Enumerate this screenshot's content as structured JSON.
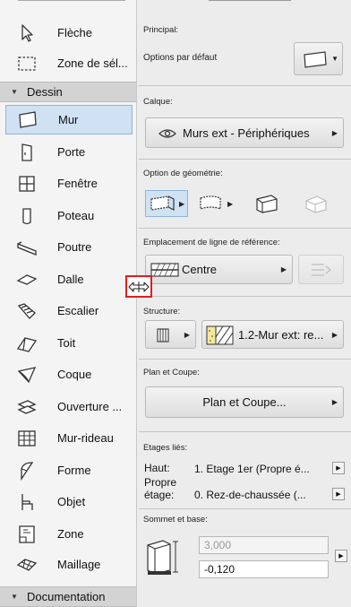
{
  "toolbox": {
    "tools_top": [
      {
        "label": "Flèche",
        "icon": "arrow-pointer-icon"
      },
      {
        "label": "Zone de sél...",
        "icon": "marquee-icon"
      }
    ],
    "section_dessin": "Dessin",
    "tools": [
      {
        "label": "Mur",
        "icon": "wall-icon",
        "selected": true
      },
      {
        "label": "Porte",
        "icon": "door-icon"
      },
      {
        "label": "Fenêtre",
        "icon": "window-icon"
      },
      {
        "label": "Poteau",
        "icon": "column-icon"
      },
      {
        "label": "Poutre",
        "icon": "beam-icon"
      },
      {
        "label": "Dalle",
        "icon": "slab-icon"
      },
      {
        "label": "Escalier",
        "icon": "stair-icon"
      },
      {
        "label": "Toit",
        "icon": "roof-icon"
      },
      {
        "label": "Coque",
        "icon": "shell-icon"
      },
      {
        "label": "Ouverture ...",
        "icon": "opening-icon"
      },
      {
        "label": "Mur-rideau",
        "icon": "curtain-wall-icon"
      },
      {
        "label": "Forme",
        "icon": "morph-icon"
      },
      {
        "label": "Objet",
        "icon": "object-chair-icon"
      },
      {
        "label": "Zone",
        "icon": "zone-icon"
      },
      {
        "label": "Maillage",
        "icon": "mesh-icon"
      }
    ],
    "section_documentation": "Documentation"
  },
  "panel": {
    "principal_caption": "Principal:",
    "options_default": "Options par défaut",
    "calque_caption": "Calque:",
    "layer_value": "Murs ext - Périphériques",
    "geometry_caption": "Option de géométrie:",
    "refline_caption": "Emplacement de ligne de référence:",
    "refline_value": "Centre",
    "structure_caption": "Structure:",
    "structure_value": "1.2-Mur ext: re...",
    "plan_caption": "Plan et Coupe:",
    "plan_button": "Plan et Coupe...",
    "floors_caption": "Etages liés:",
    "top_label": "Haut:",
    "top_value": "1. Etage 1er (Propre é...",
    "own_label_1": "Propre",
    "own_label_2": "étage:",
    "own_value": "0. Rez-de-chaussée (...",
    "topbase_caption": "Sommet et base:",
    "height_value": "3,000",
    "base_value": "-0,120"
  },
  "colors": {
    "selection_bg": "#cfe1f3",
    "selection_border": "#8fb4dc",
    "highlight_box": "#e21e1e",
    "section_header": "#d3d3d3",
    "panel_bg": "#ececec"
  }
}
